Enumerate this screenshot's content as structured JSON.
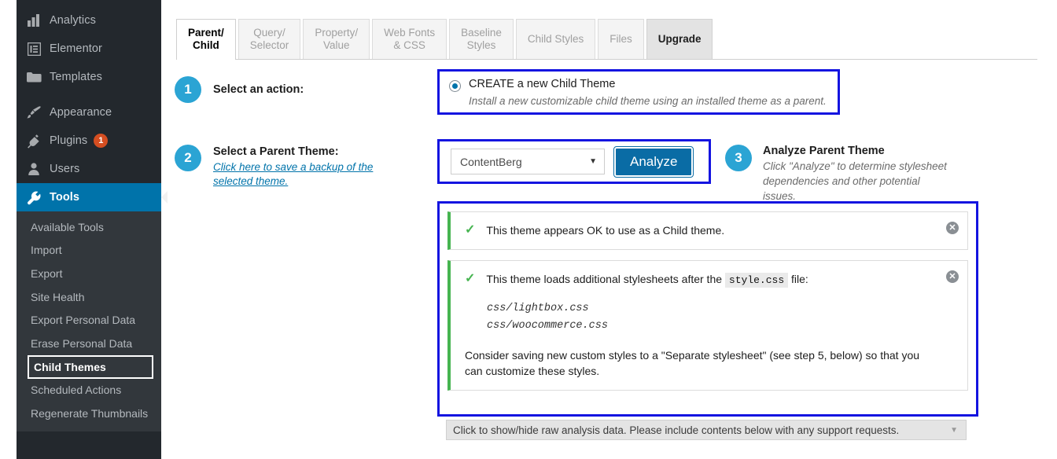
{
  "sidebar": {
    "top_items": [
      {
        "label": "Analytics",
        "icon": "bar-chart-icon",
        "badge": null
      },
      {
        "label": "Elementor",
        "icon": "elementor-icon",
        "badge": null
      },
      {
        "label": "Templates",
        "icon": "folder-icon",
        "badge": null
      },
      {
        "label": "Appearance",
        "icon": "paintbrush-icon",
        "badge": null
      },
      {
        "label": "Plugins",
        "icon": "plug-icon",
        "badge": "1"
      },
      {
        "label": "Users",
        "icon": "user-icon",
        "badge": null
      },
      {
        "label": "Tools",
        "icon": "wrench-icon",
        "badge": null
      }
    ],
    "current_item": "Tools",
    "submenu_items": [
      {
        "label": "Available Tools"
      },
      {
        "label": "Import"
      },
      {
        "label": "Export"
      },
      {
        "label": "Site Health"
      },
      {
        "label": "Export Personal Data"
      },
      {
        "label": "Erase Personal Data"
      },
      {
        "label": "Child Themes"
      },
      {
        "label": "Scheduled Actions"
      },
      {
        "label": "Regenerate Thumbnails"
      }
    ],
    "focused_submenu_item": "Child Themes",
    "accent_color": "#0073aa",
    "background_color": "#23282d",
    "submenu_background_color": "#32373c",
    "badge_color": "#d54e21"
  },
  "tabs": [
    {
      "line1": "Parent/",
      "line2": "Child",
      "state": "active-white"
    },
    {
      "line1": "Query/",
      "line2": "Selector",
      "state": "inactive"
    },
    {
      "line1": "Property/",
      "line2": "Value",
      "state": "inactive"
    },
    {
      "line1": "Web Fonts",
      "line2": "& CSS",
      "state": "inactive"
    },
    {
      "line1": "Baseline",
      "line2": "Styles",
      "state": "inactive"
    },
    {
      "line1": "Child Styles",
      "line2": "",
      "state": "inactive"
    },
    {
      "line1": "Files",
      "line2": "",
      "state": "inactive"
    },
    {
      "line1": "Upgrade",
      "line2": "",
      "state": "active-grey"
    }
  ],
  "step1": {
    "number": "1",
    "label": "Select an action:",
    "radio": {
      "selected": true,
      "title": "CREATE a new Child Theme",
      "description": "Install a new customizable child theme using an installed theme as a parent."
    }
  },
  "step2": {
    "number": "2",
    "title": "Select a Parent Theme:",
    "backup_link": "Click here to save a backup of the selected theme.",
    "select": {
      "value": "ContentBerg",
      "caret": "▼"
    },
    "analyze_button": "Analyze"
  },
  "step3": {
    "number": "3",
    "title": "Analyze Parent Theme",
    "description": "Click \"Analyze\" to determine stylesheet dependencies and other potential issues."
  },
  "results": {
    "notices": [
      {
        "check": "✓",
        "text": "This theme appears OK to use as a Child theme.",
        "close": "✕"
      },
      {
        "check": "✓",
        "text_before_code": "This theme loads additional stylesheets after the",
        "code": "style.css",
        "text_after_code": "file:",
        "files": [
          "css/lightbox.css",
          "css/woocommerce.css"
        ],
        "consider": "Consider saving new custom styles to a \"Separate stylesheet\" (see step 5, below) so that you can customize these styles.",
        "close": "✕"
      }
    ],
    "highlight_color": "#1414e0",
    "success_color": "#46b450"
  },
  "raw_bar": {
    "text": "Click to show/hide raw analysis data. Please include contents below with any support requests.",
    "caret": "▼"
  }
}
